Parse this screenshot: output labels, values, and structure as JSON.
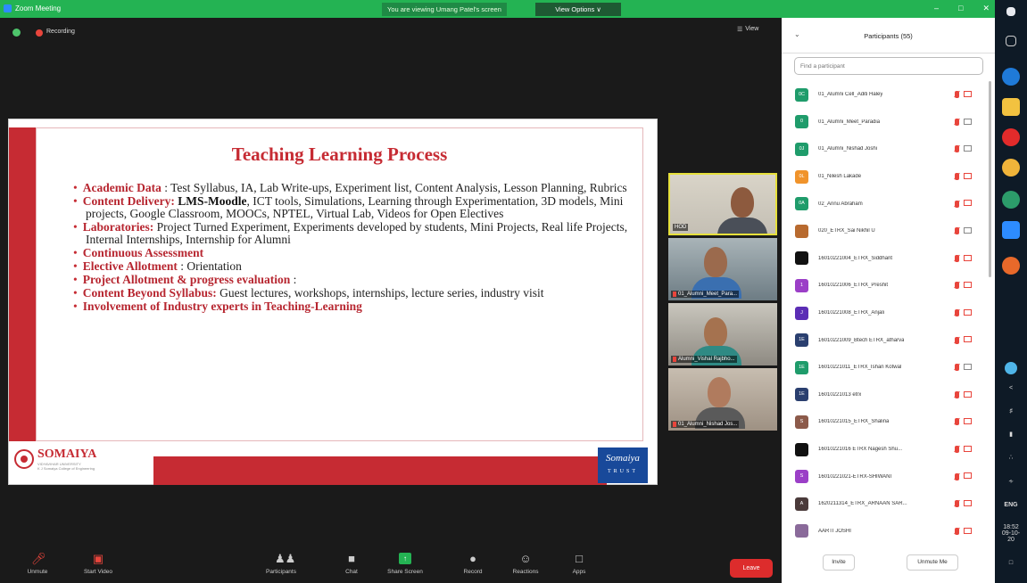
{
  "window": {
    "title": "Zoom Meeting",
    "viewing_banner": "You are viewing Umang Patel's screen",
    "view_options": "View Options ∨",
    "controls": [
      "–",
      "□",
      "✕"
    ]
  },
  "meeting_bar": {
    "recording_label": "Recording",
    "view_label": "View"
  },
  "slide": {
    "title": "Teaching Learning Process",
    "items": [
      {
        "head": "Academic Data",
        "bold": "",
        "text": " : Test Syllabus, IA, Lab Write-ups, Experiment list, Content Analysis, Lesson Planning, Rubrics"
      },
      {
        "head": "Content Delivery:",
        "bold": " LMS-Moodle",
        "text": ", ICT tools, Simulations, Learning through Experimentation, 3D models, Mini projects, Google Classroom, MOOCs, NPTEL, Virtual Lab, Videos for Open Electives"
      },
      {
        "head": "Laboratories:",
        "bold": "",
        "text": " Project Turned Experiment, Experiments developed by students, Mini Projects, Real life Projects, Internal Internships,  Internship for Alumni"
      },
      {
        "head": "Continuous Assessment",
        "bold": "",
        "text": ""
      },
      {
        "head": "Elective Allotment",
        "bold": "",
        "text": " : Orientation"
      },
      {
        "head": "Project Allotment  & progress evaluation",
        "bold": "",
        "text": " :"
      },
      {
        "head": "Content Beyond Syllabus:",
        "bold": "",
        "text": " Guest lectures, workshops, internships, lecture series, industry visit"
      },
      {
        "head": "Involvement of Industry experts  in  Teaching-Learning",
        "bold": "",
        "text": ""
      }
    ],
    "logo_name": "SOMAIYA",
    "logo_sub1": "VIDYAVIHAR UNIVERSITY",
    "logo_sub2": "K J Somaiya College of Engineering",
    "trust_script": "Somaiya",
    "trust_word": "TRUST"
  },
  "video_tiles": [
    {
      "name": "HOD",
      "active": true
    },
    {
      "name": "01_Alumni_Meet_Para...",
      "active": false
    },
    {
      "name": "Alumni_Vishal Rajbho...",
      "active": false
    },
    {
      "name": "01_Alumni_Nishad Jos...",
      "active": false
    }
  ],
  "toolbar": {
    "unmute": "Unmute",
    "start_video": "Start Video",
    "participants": "Participants",
    "participants_count": "55",
    "chat": "Chat",
    "share_screen": "Share Screen",
    "record": "Record",
    "reactions": "Reactions",
    "apps": "Apps",
    "leave": "Leave"
  },
  "participants_panel": {
    "title": "Participants (55)",
    "search_placeholder": "Find a participant",
    "invite": "Invite",
    "unmute_me": "Unmute Me",
    "list": [
      {
        "initials": "0C",
        "name": "01_Alumni Cell_Aditi Haley",
        "color": "#1f9c6b",
        "cam_red": true
      },
      {
        "initials": "0",
        "name": "01_Alumni_Meet_Paradia",
        "color": "#1f9c6b",
        "cam_red": false
      },
      {
        "initials": "0J",
        "name": "01_Alumni_Nishad Joshi",
        "color": "#1f9c6b",
        "cam_red": false
      },
      {
        "initials": "0L",
        "name": "01_Nilesh Lakade",
        "color": "#f0932b",
        "cam_red": true
      },
      {
        "initials": "0A",
        "name": "02_Annu Abraham",
        "color": "#1f9c6b",
        "cam_red": true
      },
      {
        "initials": "",
        "name": "020_ETRX_Sai Nikhil U",
        "color": "#b86a2f",
        "cam_red": false
      },
      {
        "initials": "",
        "name": "16010221004_ETRX_Siddhant",
        "color": "#111111",
        "cam_red": true
      },
      {
        "initials": "1",
        "name": "16010221006_ETRX_Preshit",
        "color": "#9b3fc7",
        "cam_red": true
      },
      {
        "initials": "J",
        "name": "16010221008_ETRX_Anjali",
        "color": "#5b2db5",
        "cam_red": true
      },
      {
        "initials": "1E",
        "name": "16010221009_Btech ETRX_atharva",
        "color": "#2a3f6f",
        "cam_red": true
      },
      {
        "initials": "1E",
        "name": "16010221011_ETRX_Ishan Kotwal",
        "color": "#1f9c6b",
        "cam_red": false
      },
      {
        "initials": "1E",
        "name": "16010221013 etrx",
        "color": "#2a3f6f",
        "cam_red": true
      },
      {
        "initials": "S",
        "name": "16010221015_ETRX_Shalina",
        "color": "#8c5a4a",
        "cam_red": true
      },
      {
        "initials": "",
        "name": "16010221016 ETRX Nagesh Shu...",
        "color": "#111111",
        "cam_red": true
      },
      {
        "initials": "S",
        "name": "16010221021-ETRX-SHIWANI",
        "color": "#9b3fc7",
        "cam_red": true
      },
      {
        "initials": "A",
        "name": "1620211314_ETRX_ARNAAN SAR...",
        "color": "#4a3a3a",
        "cam_red": true
      },
      {
        "initials": "",
        "name": "AARTI JOSHI",
        "color": "#8a6a9a",
        "cam_red": true
      }
    ]
  },
  "taskbar": {
    "lang": "ENG",
    "time": "18:52",
    "date": "09-10-20"
  }
}
